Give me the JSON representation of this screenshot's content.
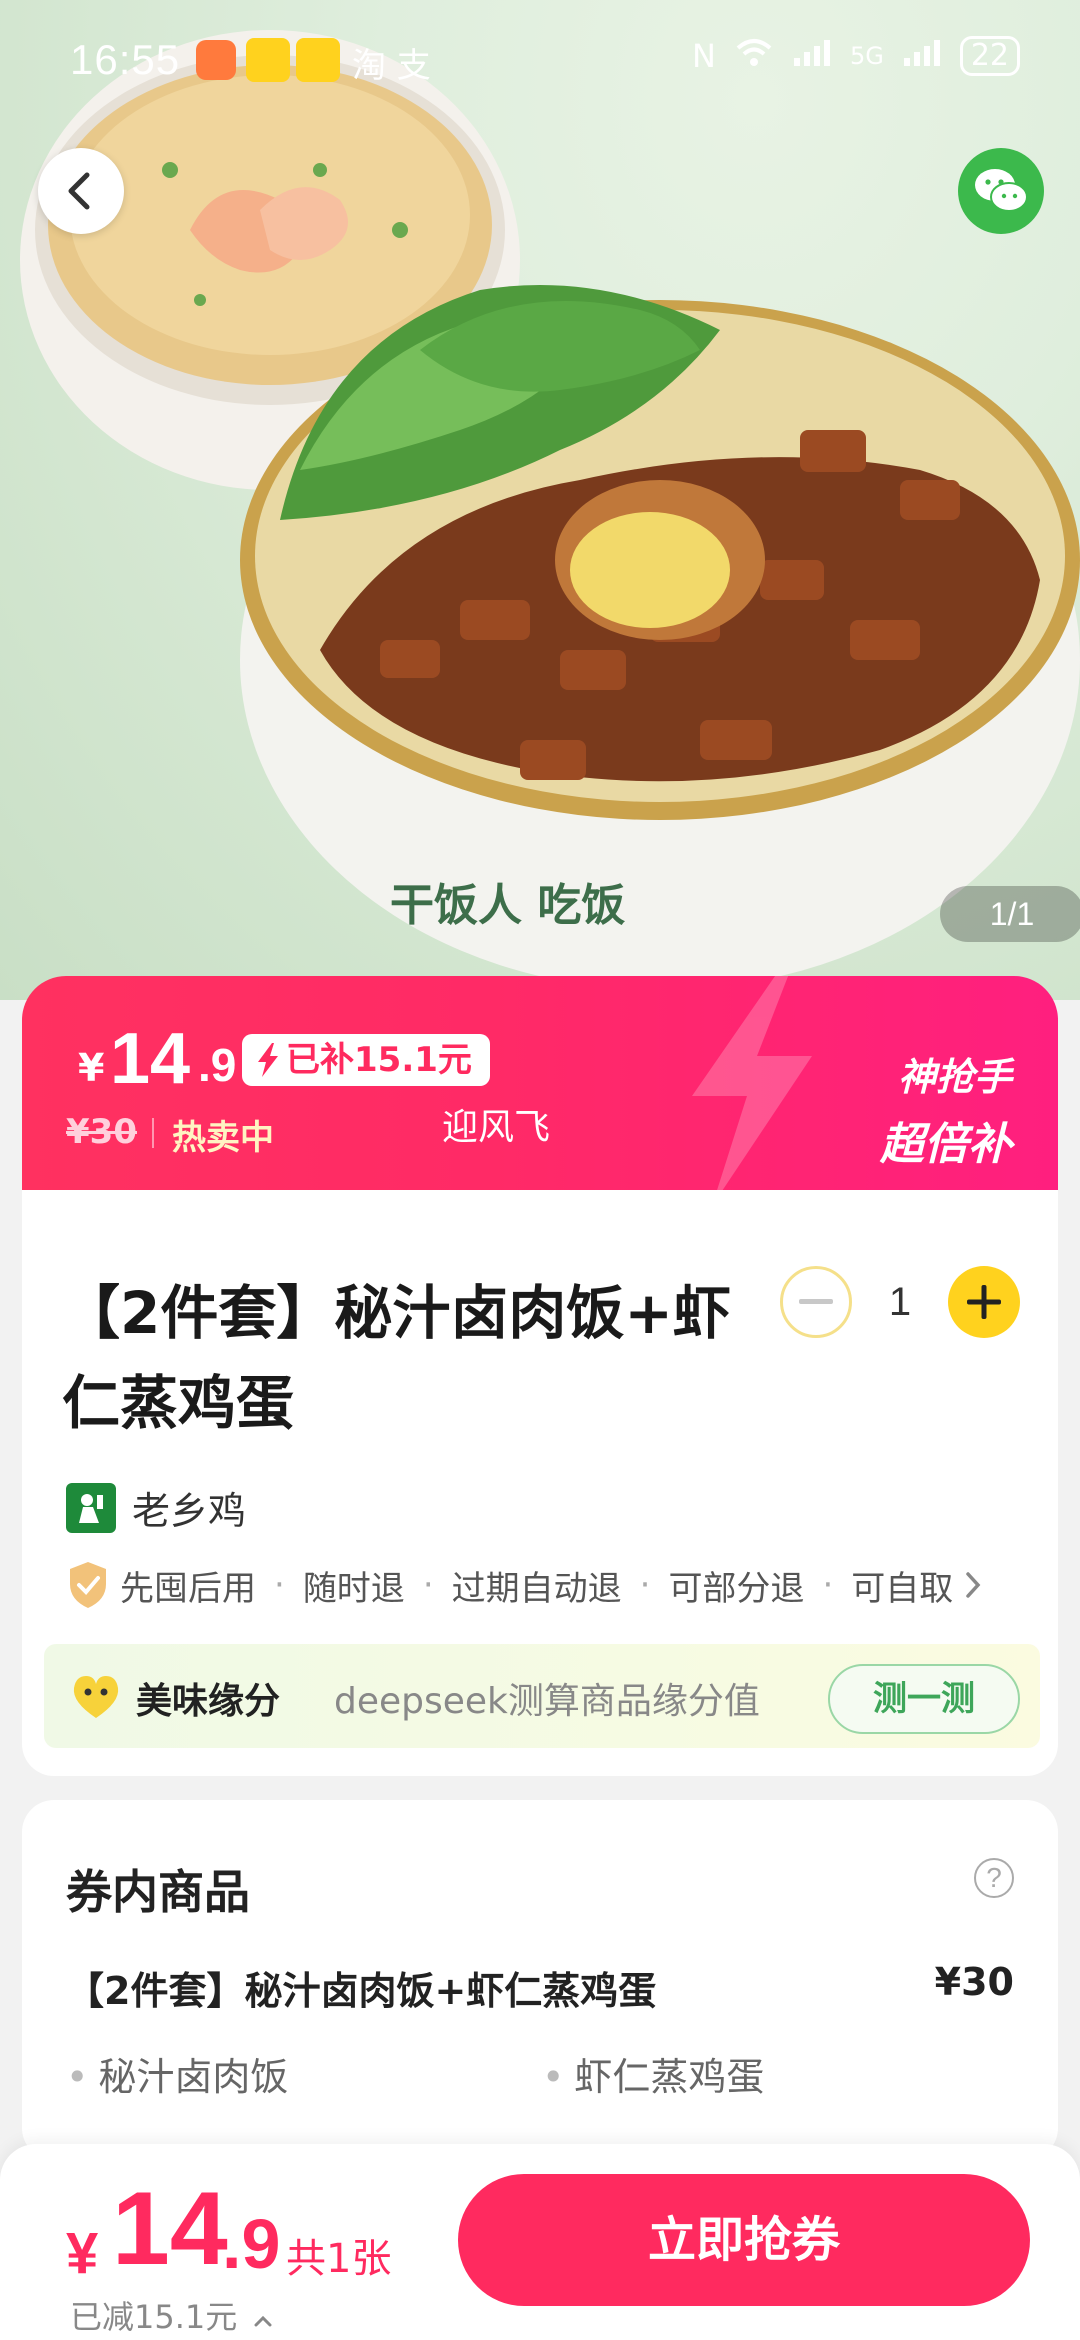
{
  "status_bar": {
    "time": "16:55",
    "misc_text": "淘 支",
    "network": "5G",
    "battery": "22"
  },
  "gallery": {
    "counter": "1/1"
  },
  "promo": {
    "yen": "¥",
    "price_int": "14",
    "price_dec": ".9",
    "subsidy": "已补15.1元",
    "original_price": "¥30",
    "hot_text": "热卖中",
    "shop_text": "迎风飞",
    "flash_line1": "神抢手",
    "flash_line2": "超倍补"
  },
  "product": {
    "title": "【2件套】秘汁卤肉饭+虾仁蒸鸡蛋",
    "quantity": "1",
    "merchant": "老乡鸡",
    "tags": [
      "先囤后用",
      "随时退",
      "过期自动退",
      "可部分退",
      "可自取"
    ],
    "fate_title": "美味缘分",
    "fate_desc": "deepseek测算商品缘分值",
    "fate_button": "测一测"
  },
  "included": {
    "title": "券内商品",
    "item_name": "【2件套】秘汁卤肉饭+虾仁蒸鸡蛋",
    "item_price": "¥30",
    "sub_items": [
      "秘汁卤肉饭",
      "虾仁蒸鸡蛋"
    ]
  },
  "bottom_bar": {
    "yen": "¥",
    "price_int": "14",
    "price_dec": ".9",
    "count": "共1张",
    "saved": "已减15.1元",
    "buy_label": "立即抢券"
  },
  "colors": {
    "accent": "#ff2a5f",
    "yellow": "#ffd21e",
    "green": "#3cb94c"
  }
}
